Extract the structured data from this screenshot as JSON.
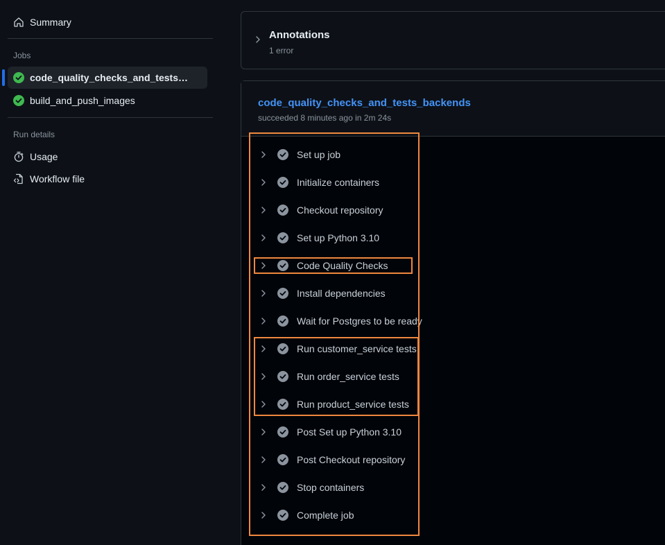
{
  "sidebar": {
    "summary_label": "Summary",
    "jobs_title": "Jobs",
    "jobs": [
      {
        "label": "code_quality_checks_and_tests_backends",
        "status": "success"
      },
      {
        "label": "build_and_push_images",
        "status": "success"
      }
    ],
    "run_details_title": "Run details",
    "usage_label": "Usage",
    "workflow_file_label": "Workflow file"
  },
  "annotations": {
    "title": "Annotations",
    "subtitle": "1 error"
  },
  "job": {
    "title": "code_quality_checks_and_tests_backends",
    "subtitle": "succeeded 8 minutes ago in 2m 24s",
    "steps": [
      {
        "label": "Set up job",
        "status": "success"
      },
      {
        "label": "Initialize containers",
        "status": "success"
      },
      {
        "label": "Checkout repository",
        "status": "success"
      },
      {
        "label": "Set up Python 3.10",
        "status": "success"
      },
      {
        "label": "Code Quality Checks",
        "status": "success"
      },
      {
        "label": "Install dependencies",
        "status": "success"
      },
      {
        "label": "Wait for Postgres to be ready",
        "status": "success"
      },
      {
        "label": "Run customer_service tests",
        "status": "success"
      },
      {
        "label": "Run order_service tests",
        "status": "success"
      },
      {
        "label": "Run product_service tests",
        "status": "success"
      },
      {
        "label": "Post Set up Python 3.10",
        "status": "success"
      },
      {
        "label": "Post Checkout repository",
        "status": "success"
      },
      {
        "label": "Stop containers",
        "status": "success"
      },
      {
        "label": "Complete job",
        "status": "success"
      }
    ]
  },
  "colors": {
    "background": "#0d1117",
    "success": "#3fb950",
    "step_check": "#8b949e",
    "link": "#4493f8",
    "highlight": "#f0883e",
    "active_bar": "#1f6feb"
  }
}
